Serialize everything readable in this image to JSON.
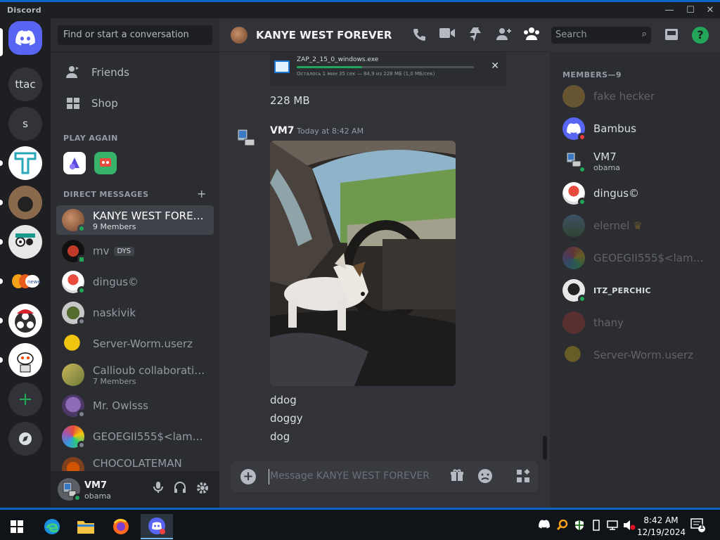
{
  "window": {
    "title": "Discord",
    "minimize": "—",
    "maximize": "☐",
    "close": "✕"
  },
  "rail": {
    "servers": [
      {
        "label": "ttac"
      },
      {
        "label": "s"
      }
    ]
  },
  "sidebar": {
    "search_placeholder": "Find or start a conversation",
    "nav": [
      {
        "label": "Friends"
      },
      {
        "label": "Shop"
      }
    ],
    "play_again_title": "PLAY AGAIN",
    "dm_title": "DIRECT MESSAGES",
    "dm_add": "+",
    "dms": [
      {
        "name": "KANYE WEST FOREVER",
        "sub": "9 Members"
      },
      {
        "name": "mv",
        "tag": "DYS"
      },
      {
        "name": "dingus©"
      },
      {
        "name": "naskivik"
      },
      {
        "name": "Server-Worm.userz"
      },
      {
        "name": "Callioub collaborating on...",
        "sub": "7 Members"
      },
      {
        "name": "Mr. Owlsss"
      },
      {
        "name": "GEOEGII555$<lambda>..."
      },
      {
        "name": "CHOCOLATEMAN"
      }
    ]
  },
  "user_panel": {
    "name": "VM7",
    "status": "obama"
  },
  "chat": {
    "title": "KANYE WEST FOREVER",
    "upload": {
      "filename": "ZAP_2_15_0_windows.exe",
      "progress": 0.37,
      "info": "Осталось 1 мин 35 сек — 84,9 из 228 МБ (1,0 МБ/сек)",
      "close": "✕"
    },
    "messages": [
      {
        "text": "228 MB"
      }
    ],
    "author": "VM7",
    "timestamp": "Today at 8:42 AM",
    "followups": [
      "ddog",
      "doggy",
      "dog"
    ],
    "composer_placeholder": "Message KANYE WEST FOREVER"
  },
  "members": {
    "search_placeholder": "Search",
    "title": "MEMBERS—9",
    "list": [
      {
        "name": "fake hecker"
      },
      {
        "name": "Bambus"
      },
      {
        "name": "VM7",
        "sub": "obama"
      },
      {
        "name": "dingus©"
      },
      {
        "name": "elernel",
        "badge": "♛"
      },
      {
        "name": "GEOEGII555$<lambda>..."
      },
      {
        "name": "ITZ_PERCHIC"
      },
      {
        "name": "thany"
      },
      {
        "name": "Server-Worm.userz"
      }
    ]
  },
  "taskbar": {
    "time": "8:42 AM",
    "date": "12/19/2024",
    "notification_count": "1"
  },
  "colors": {
    "accent": "#5865f2",
    "online": "#23a55a",
    "dnd": "#f23f43",
    "taskbar_accent": "#0e63c7"
  },
  "icons": [
    "discord-icon",
    "friends-icon",
    "shop-icon",
    "phone-icon",
    "video-icon",
    "pin-icon",
    "add-member-icon",
    "members-icon",
    "search-icon",
    "inbox-icon",
    "help-icon",
    "mic-icon",
    "headphones-icon",
    "settings-icon",
    "gift-icon",
    "emoji-icon",
    "apps-icon"
  ]
}
